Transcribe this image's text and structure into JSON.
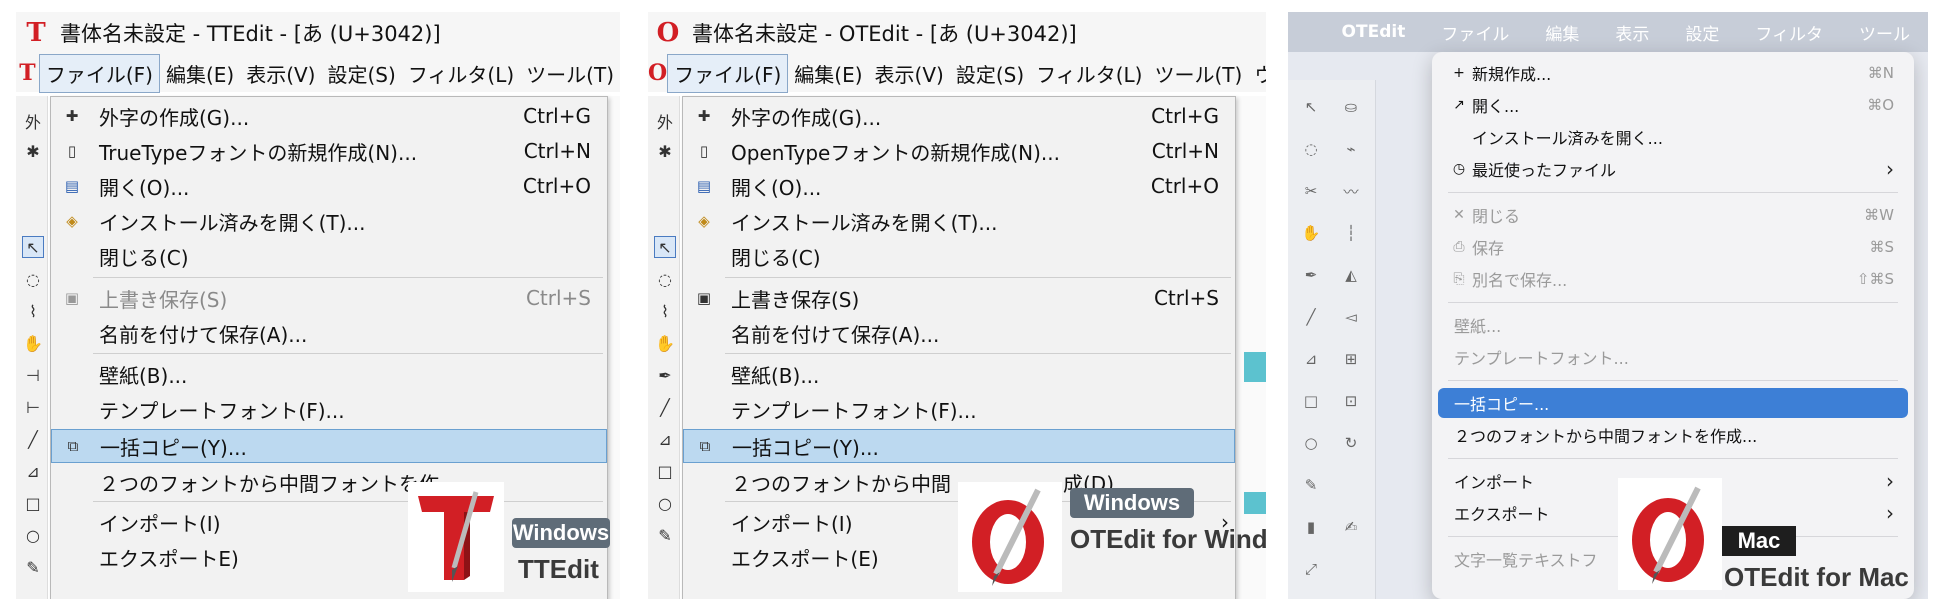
{
  "colors": {
    "win_highlight": "#bcd9f0",
    "mac_highlight": "#3d7fd6",
    "logo_red": "#d21f25",
    "os_pill": "#5f6c78",
    "teal_decor": "#5cc2cf"
  },
  "tt": {
    "window_title": "書体名未設定 - TTEdit - [あ (U+3042)]",
    "menubar": [
      "ファイル(F)",
      "編集(E)",
      "表示(V)",
      "設定(S)",
      "フィルタ(L)",
      "ツール(T)"
    ],
    "file_menu": [
      {
        "icon": "gaiji-icon",
        "label": "外字の作成(G)...",
        "shortcut": "Ctrl+G"
      },
      {
        "icon": "new-file-icon",
        "label": "TrueTypeフォントの新規作成(N)...",
        "shortcut": "Ctrl+N"
      },
      {
        "icon": "open-icon",
        "label": "開く(O)...",
        "shortcut": "Ctrl+O"
      },
      {
        "icon": "installed-font-icon",
        "label": "インストール済みを開く(T)...",
        "shortcut": ""
      },
      {
        "icon": "",
        "label": "閉じる(C)",
        "shortcut": ""
      },
      {
        "icon": "save-icon",
        "label": "上書き保存(S)",
        "shortcut": "Ctrl+S",
        "disabled": true
      },
      {
        "icon": "",
        "label": "名前を付けて保存(A)...",
        "shortcut": ""
      },
      {
        "icon": "",
        "label": "壁紙(B)...",
        "shortcut": ""
      },
      {
        "icon": "",
        "label": "テンプレートフォント(F)...",
        "shortcut": ""
      },
      {
        "icon": "batch-copy-icon",
        "label": "一括コピー(Y)...",
        "shortcut": "",
        "highlighted": true
      },
      {
        "icon": "",
        "label": "２つのフォントから中間フォントを作",
        "shortcut": ""
      },
      {
        "icon": "",
        "label": "インポート(I)",
        "shortcut": ""
      },
      {
        "icon": "",
        "label": "エクスポートE)",
        "shortcut": ""
      }
    ],
    "badge_os": "Windows",
    "badge_product": "TTEdit"
  },
  "ot": {
    "window_title": "書体名未設定 - OTEdit - [あ (U+3042)]",
    "menubar": [
      "ファイル(F)",
      "編集(E)",
      "表示(V)",
      "設定(S)",
      "フィルタ(L)",
      "ツール(T)",
      "ウ"
    ],
    "file_menu": [
      {
        "icon": "gaiji-icon",
        "label": "外字の作成(G)...",
        "shortcut": "Ctrl+G"
      },
      {
        "icon": "new-file-icon",
        "label": "OpenTypeフォントの新規作成(N)...",
        "shortcut": "Ctrl+N"
      },
      {
        "icon": "open-icon",
        "label": "開く(O)...",
        "shortcut": "Ctrl+O"
      },
      {
        "icon": "installed-font-icon",
        "label": "インストール済みを開く(T)...",
        "shortcut": ""
      },
      {
        "icon": "",
        "label": "閉じる(C)",
        "shortcut": ""
      },
      {
        "icon": "save-icon",
        "label": "上書き保存(S)",
        "shortcut": "Ctrl+S"
      },
      {
        "icon": "",
        "label": "名前を付けて保存(A)...",
        "shortcut": ""
      },
      {
        "icon": "",
        "label": "壁紙(B)...",
        "shortcut": ""
      },
      {
        "icon": "",
        "label": "テンプレートフォント(F)...",
        "shortcut": ""
      },
      {
        "icon": "batch-copy-icon",
        "label": "一括コピー(Y)...",
        "shortcut": "",
        "highlighted": true
      },
      {
        "icon": "",
        "label": "２つのフォントから中間",
        "label2": "成(D)...",
        "shortcut": ""
      },
      {
        "icon": "",
        "label": "インポート(I)",
        "shortcut": ""
      },
      {
        "icon": "",
        "label": "エクスポート(E)",
        "shortcut": ""
      }
    ],
    "badge_os": "Windows",
    "badge_product": "OTEdit for Windows"
  },
  "mac": {
    "menubar": [
      "OTEdit",
      "ファイル",
      "編集",
      "表示",
      "設定",
      "フィルタ",
      "ツール"
    ],
    "file_menu": [
      {
        "icon": "plus-icon",
        "label": "新規作成...",
        "shortcut": "⌘N"
      },
      {
        "icon": "arrow-open-icon",
        "label": "開く...",
        "shortcut": "⌘O"
      },
      {
        "icon": "",
        "label": "インストール済みを開く...",
        "shortcut": ""
      },
      {
        "icon": "clock-icon",
        "label": "最近使ったファイル",
        "shortcut": "",
        "submenu": true
      },
      {
        "icon": "close-x-icon",
        "label": "閉じる",
        "shortcut": "⌘W",
        "disabled": true
      },
      {
        "icon": "save-icon",
        "label": "保存",
        "shortcut": "⌘S",
        "disabled": true
      },
      {
        "icon": "save-as-icon",
        "label": "別名で保存...",
        "shortcut": "⇧⌘S",
        "disabled": true
      },
      {
        "icon": "",
        "label": "壁紙...",
        "shortcut": "",
        "disabled": true
      },
      {
        "icon": "",
        "label": "テンプレートフォント...",
        "shortcut": "",
        "disabled": true
      },
      {
        "icon": "",
        "label": "一括コピー...",
        "shortcut": "",
        "highlighted": true
      },
      {
        "icon": "",
        "label": "２つのフォントから中間フォントを作成...",
        "shortcut": ""
      },
      {
        "icon": "",
        "label": "インポート",
        "shortcut": "",
        "submenu": true
      },
      {
        "icon": "",
        "label": "エクスポート",
        "shortcut": "",
        "submenu": true
      },
      {
        "icon": "",
        "label": "文字一覧テキストフ",
        "shortcut": "",
        "disabled": true
      }
    ],
    "badge_os": "Mac",
    "badge_product": "OTEdit for Mac"
  },
  "tt_logo_letter": "T",
  "ot_logo_letter": "O",
  "apple_glyph": "",
  "submenu_arrow": "›"
}
